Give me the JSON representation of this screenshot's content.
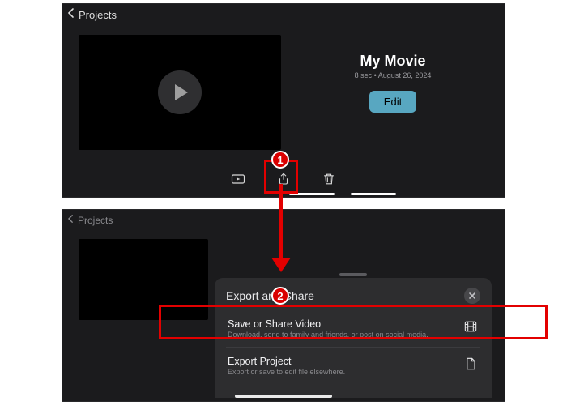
{
  "nav": {
    "back_label": "Projects"
  },
  "project": {
    "title": "My Movie",
    "duration": "8 sec",
    "date": "August 26, 2024",
    "edit_label": "Edit"
  },
  "toolbar": {
    "play_icon": "play-rect-icon",
    "share_icon": "share-icon",
    "delete_icon": "trash-icon"
  },
  "sheet": {
    "title": "Export and Share",
    "rows": [
      {
        "title": "Save or Share Video",
        "subtitle": "Download, send to family and friends, or post on social media.",
        "icon": "film-icon"
      },
      {
        "title": "Export Project",
        "subtitle": "Export or save to edit file elsewhere.",
        "icon": "document-icon"
      }
    ]
  },
  "annotations": {
    "step1": "1",
    "step2": "2"
  }
}
